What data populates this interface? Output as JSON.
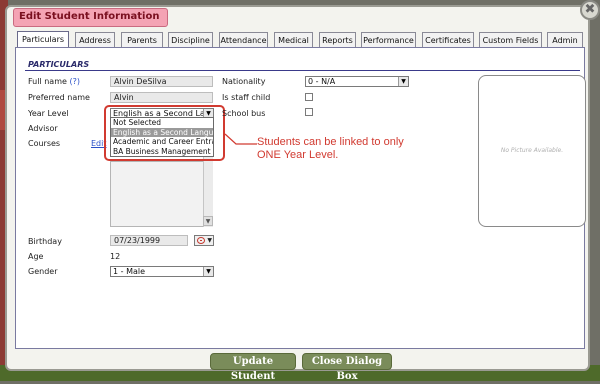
{
  "dialog": {
    "title": "Edit Student Information",
    "close_glyph": "✖",
    "tabs": [
      "Particulars",
      "Address",
      "Parents",
      "Discipline",
      "Attendance",
      "Medical",
      "Reports",
      "Performance",
      "Certificates",
      "Custom Fields",
      "Admin"
    ],
    "active_tab": "Particulars"
  },
  "section": {
    "title": "PARTICULARS"
  },
  "fields": {
    "full_name_label": "Full name",
    "full_name_help": "(?)",
    "full_name_value": "Alvin DeSilva",
    "preferred_name_label": "Preferred name",
    "preferred_name_value": "Alvin",
    "year_level_label": "Year Level",
    "year_level_value": "English as a Second Langu",
    "advisor_label": "Advisor",
    "courses_label": "Courses",
    "courses_edit_link": "Edit",
    "nationality_label": "Nationality",
    "nationality_value": "0 - N/A",
    "staff_child_label": "Is staff child",
    "school_bus_label": "School bus",
    "birthday_label": "Birthday",
    "birthday_value": "07/23/1999",
    "age_label": "Age",
    "age_value": "12",
    "gender_label": "Gender",
    "gender_value": "1 - Male"
  },
  "year_level_options": [
    {
      "label": "Not Selected",
      "highlighted": false
    },
    {
      "label": "English as a Second Languag",
      "highlighted": true
    },
    {
      "label": "Academic and Career Entranc",
      "highlighted": false
    },
    {
      "label": "BA Business Management",
      "highlighted": false
    }
  ],
  "annotation": {
    "line1": "Students can be linked to only",
    "line2": "ONE Year Level.",
    "color": "#d13a30"
  },
  "picture": {
    "placeholder": "No Picture Available."
  },
  "buttons": {
    "update": "Update Student",
    "close": "Close Dialog Box"
  },
  "colors": {
    "title_tab": "#f4a3b4",
    "button": "#7a8c5a",
    "section_rule": "#3a3a8a"
  }
}
